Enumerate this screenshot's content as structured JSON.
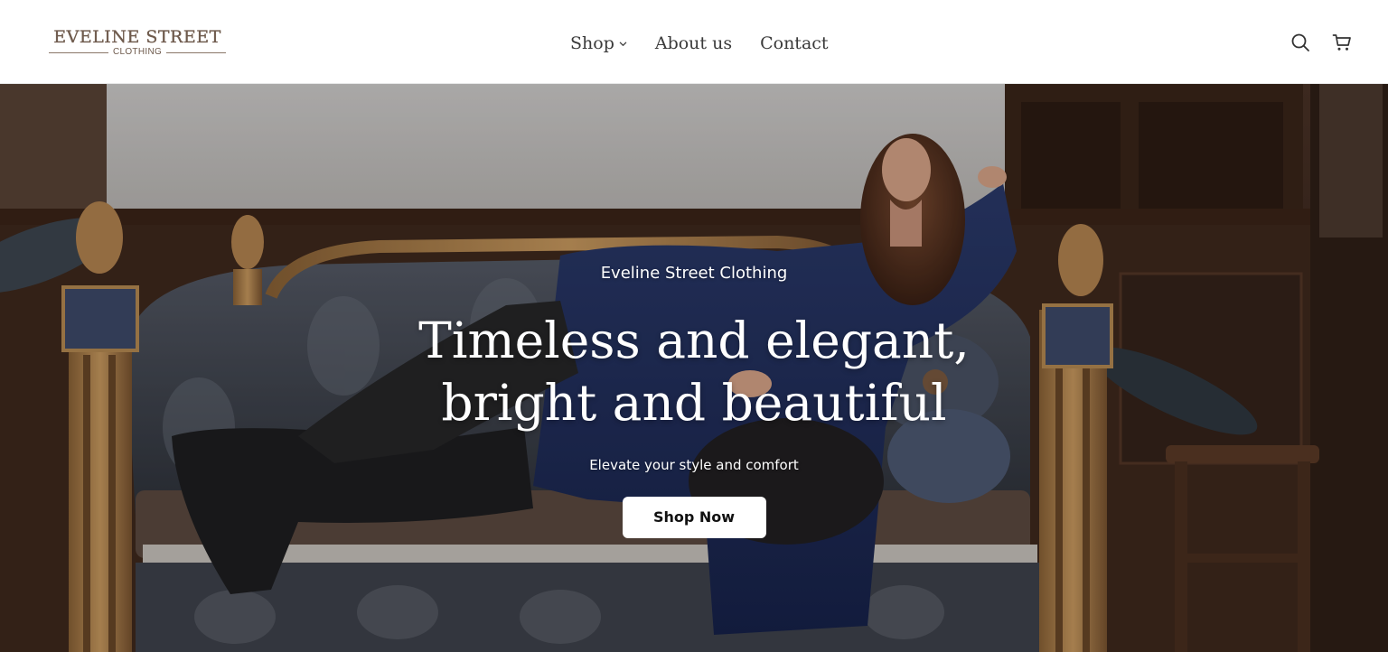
{
  "brand": {
    "name": "EVELINE STREET",
    "tagline": "CLOTHING",
    "color": "#6e5a4c"
  },
  "nav": {
    "items": [
      {
        "label": "Shop",
        "has_dropdown": true,
        "icon": "chevron-down-icon"
      },
      {
        "label": "About us"
      },
      {
        "label": "Contact"
      }
    ]
  },
  "header_actions": {
    "search_icon": "search-icon",
    "cart_icon": "cart-icon"
  },
  "hero": {
    "eyebrow": "Eveline Street Clothing",
    "title_line1": "Timeless and elegant,",
    "title_line2": "bright and beautiful",
    "subtitle": "Elevate your style and comfort",
    "cta_label": "Shop Now",
    "cta_bg": "#ffffff",
    "text_color": "#ffffff"
  }
}
